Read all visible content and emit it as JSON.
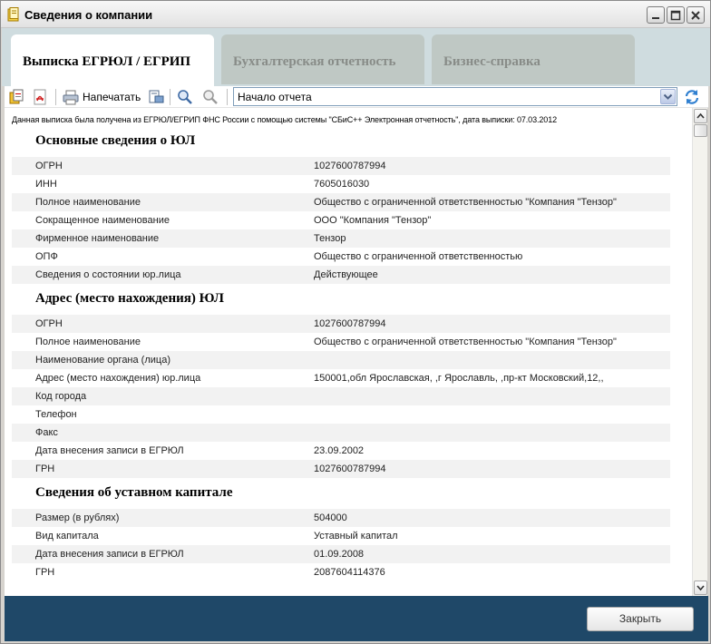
{
  "window": {
    "title": "Сведения о компании"
  },
  "tabs": [
    {
      "label": "Выписка ЕГРЮЛ / ЕГРИП"
    },
    {
      "label": "Бухгалтерская отчетность"
    },
    {
      "label": "Бизнес-справка"
    }
  ],
  "toolbar": {
    "print_label": "Напечатать",
    "section_select_value": "Начало отчета"
  },
  "report": {
    "notice": "Данная выписка была получена из ЕГРЮЛ/ЕГРИП ФНС России с помощью системы \"СБиС++ Электронная отчетность\", дата выписки: 07.03.2012",
    "sections": [
      {
        "title": "Основные сведения о ЮЛ",
        "rows": [
          {
            "key": "ОГРН",
            "value": "1027600787994"
          },
          {
            "key": "ИНН",
            "value": "7605016030"
          },
          {
            "key": "Полное наименование",
            "value": "Общество с ограниченной ответственностью \"Компания \"Тензор\""
          },
          {
            "key": "Сокращенное наименование",
            "value": "ООО \"Компания \"Тензор\""
          },
          {
            "key": "Фирменное наименование",
            "value": "Тензор"
          },
          {
            "key": "ОПФ",
            "value": "Общество с ограниченной ответственностью"
          },
          {
            "key": "Сведения о состоянии юр.лица",
            "value": "Действующее"
          }
        ]
      },
      {
        "title": "Адрес (место нахождения) ЮЛ",
        "rows": [
          {
            "key": "ОГРН",
            "value": "1027600787994"
          },
          {
            "key": "Полное наименование",
            "value": "Общество с ограниченной ответственностью \"Компания \"Тензор\""
          },
          {
            "key": "Наименование органа (лица)",
            "value": ""
          },
          {
            "key": "Адрес (место нахождения) юр.лица",
            "value": "150001,обл Ярославская, ,г Ярославль, ,пр-кт Московский,12,,"
          },
          {
            "key": "Код города",
            "value": ""
          },
          {
            "key": "Телефон",
            "value": ""
          },
          {
            "key": "Факс",
            "value": ""
          },
          {
            "key": "Дата внесения записи в ЕГРЮЛ",
            "value": "23.09.2002"
          },
          {
            "key": "ГРН",
            "value": "1027600787994"
          }
        ]
      },
      {
        "title": "Сведения об уставном капитале",
        "rows": [
          {
            "key": "Размер (в рублях)",
            "value": "504000"
          },
          {
            "key": "Вид капитала",
            "value": "Уставный капитал"
          },
          {
            "key": "Дата внесения записи в ЕГРЮЛ",
            "value": "01.09.2008"
          },
          {
            "key": "ГРН",
            "value": "2087604114376"
          }
        ]
      }
    ]
  },
  "footer": {
    "close_label": "Закрыть"
  },
  "colors": {
    "footer_bg": "#1f4868",
    "tabs_bg": "#cfdcdf"
  }
}
